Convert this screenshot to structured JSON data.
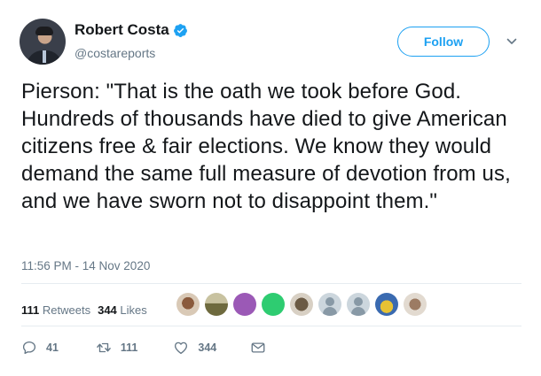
{
  "author": {
    "display_name": "Robert Costa",
    "handle": "@costareports",
    "verified": true
  },
  "follow_button": {
    "label": "Follow"
  },
  "tweet": {
    "text": "Pierson: \"That is the oath we took before God. Hundreds of thousands have died to give American citizens free & fair elections. We know they would demand the same full measure of devotion from us, and we have sworn not to disappoint them.\"",
    "timestamp": "11:56 PM - 14 Nov 2020"
  },
  "stats": {
    "retweets_count": "111",
    "retweets_label": "Retweets",
    "likes_count": "344",
    "likes_label": "Likes"
  },
  "actions": {
    "reply_count": "41",
    "retweet_count": "111",
    "like_count": "344"
  },
  "colors": {
    "accent": "#1da1f2",
    "text_primary": "#14171a",
    "text_secondary": "#657786",
    "divider": "#e6ecf0"
  }
}
